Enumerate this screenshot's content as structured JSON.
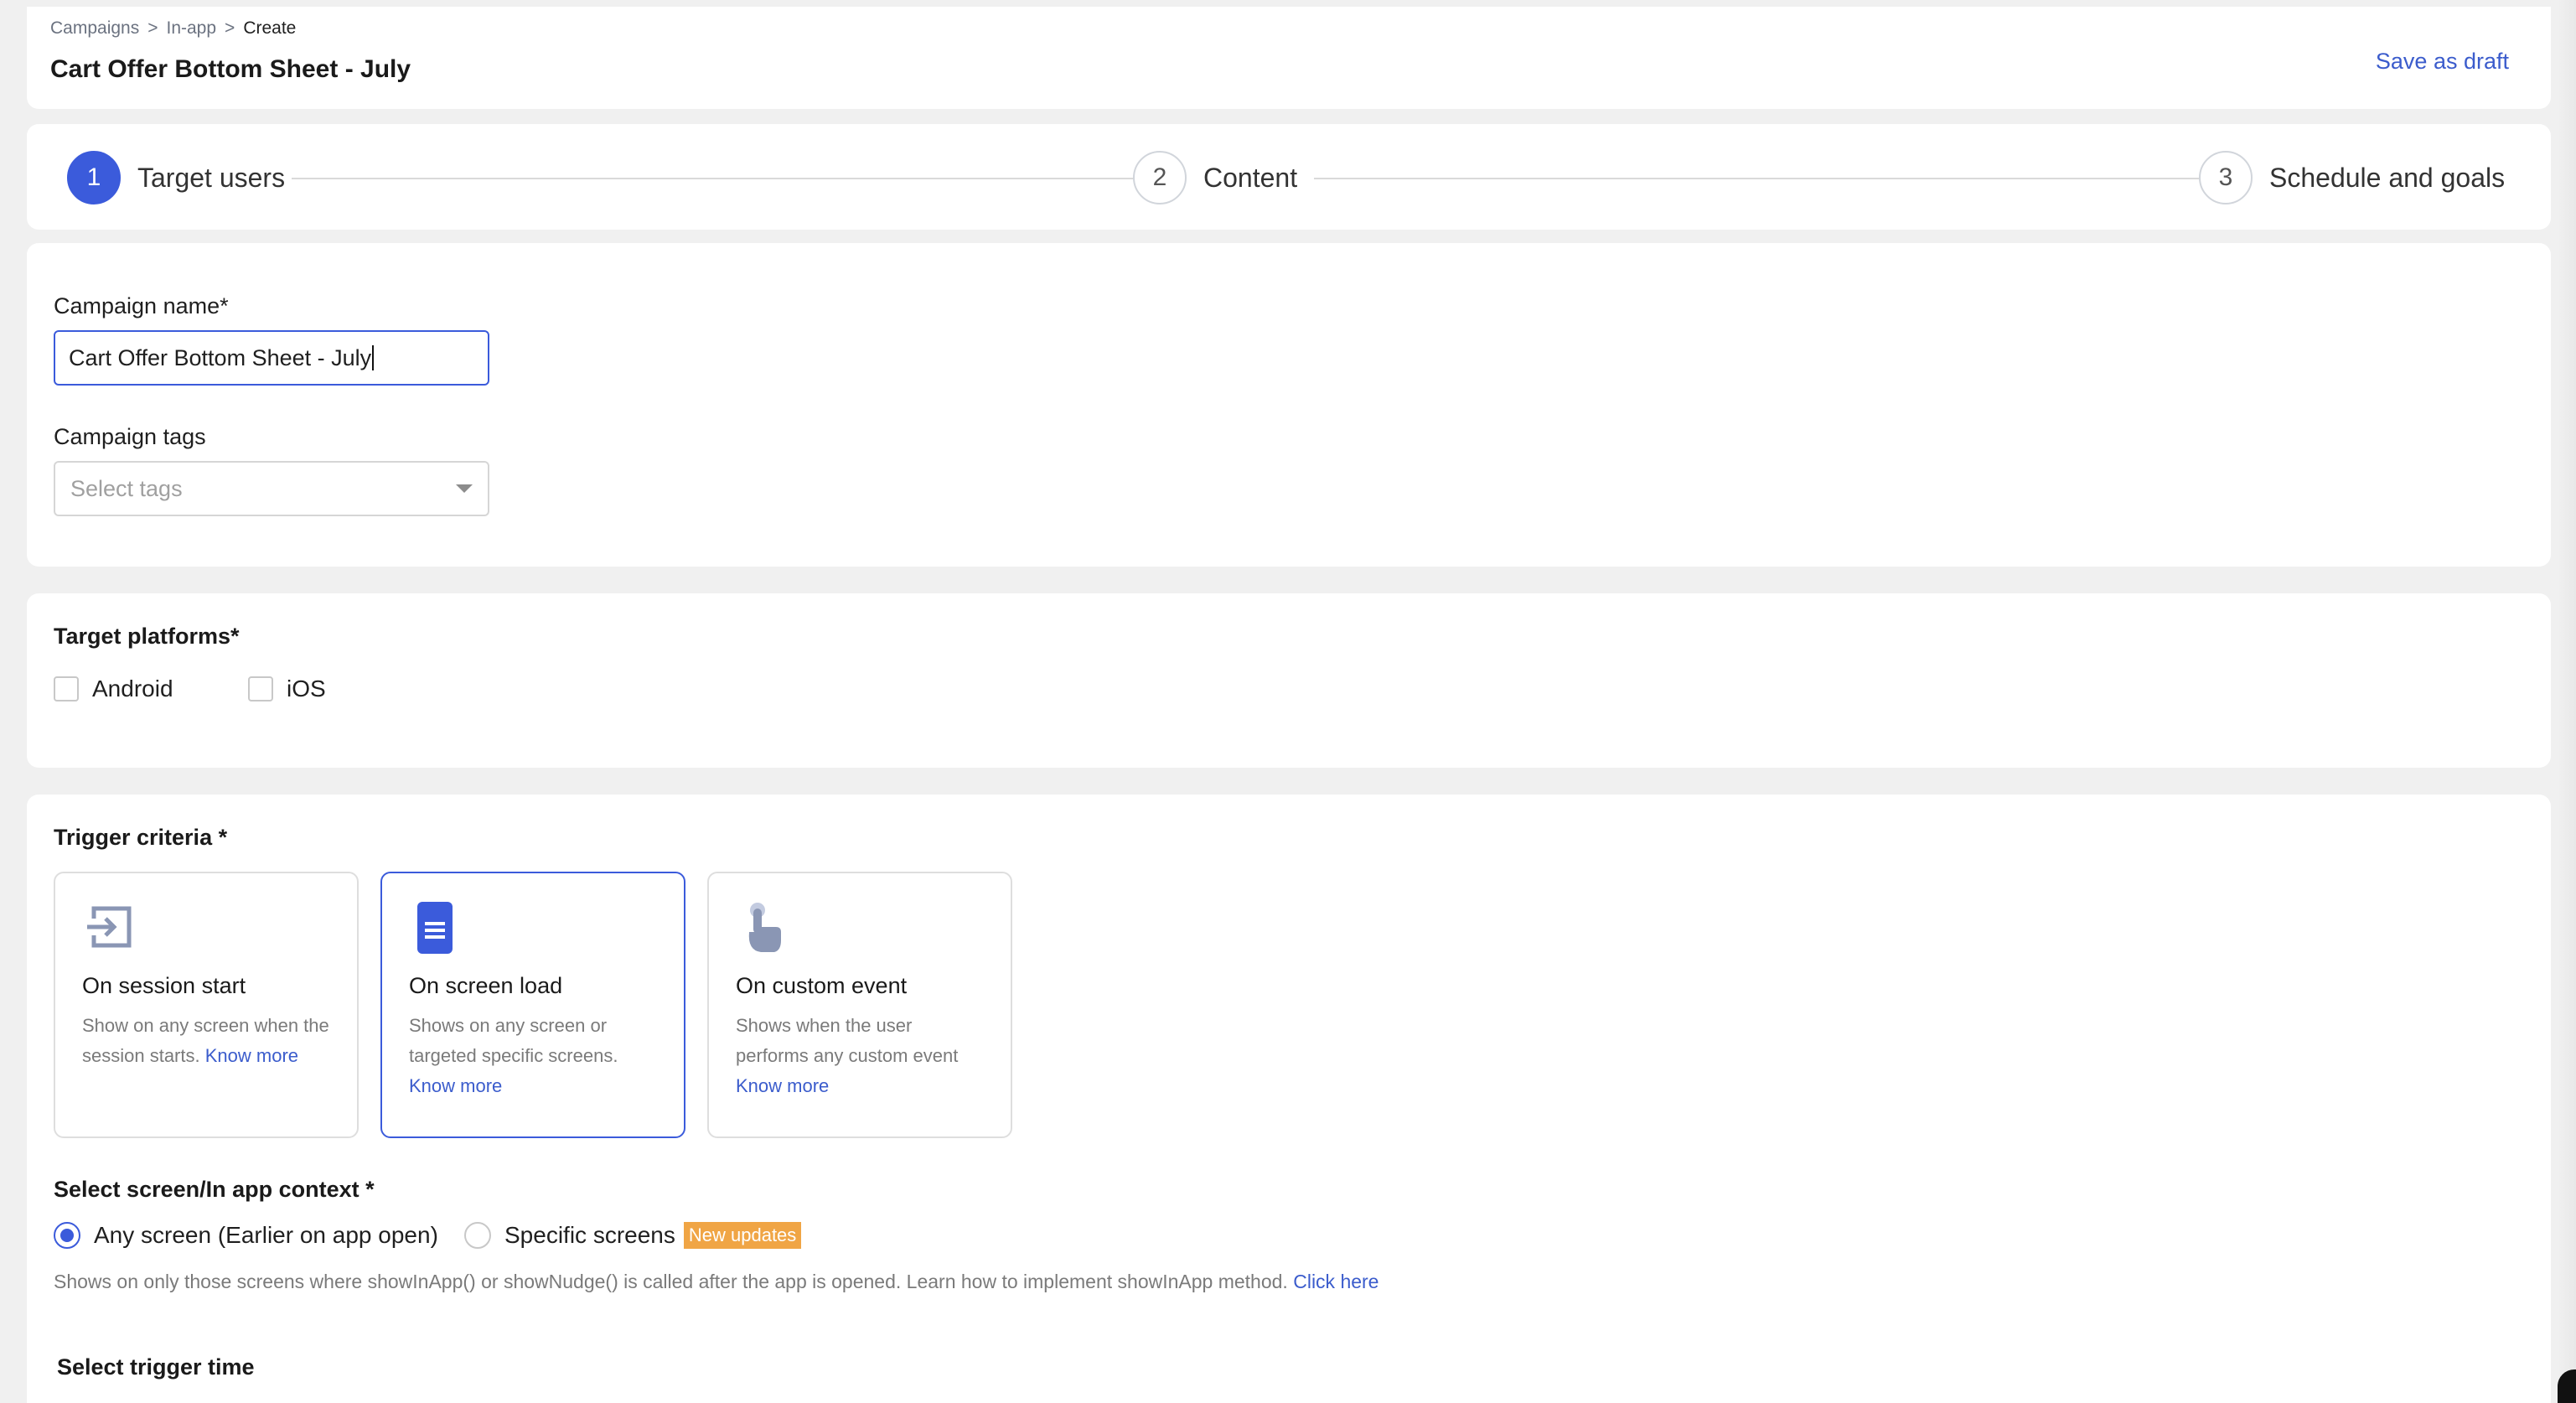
{
  "breadcrumb": [
    "Campaigns",
    ">",
    "In-app",
    ">",
    "Create"
  ],
  "header": {
    "title": "Cart Offer Bottom Sheet - July",
    "save_draft": "Save as draft"
  },
  "stepper": [
    {
      "num": "1",
      "label": "Target users",
      "active": true
    },
    {
      "num": "2",
      "label": "Content",
      "active": false
    },
    {
      "num": "3",
      "label": "Schedule and goals",
      "active": false
    }
  ],
  "campaign": {
    "name_label": "Campaign name*",
    "name_value": "Cart Offer Bottom Sheet - July",
    "tags_label": "Campaign tags",
    "tags_placeholder": "Select tags"
  },
  "platforms": {
    "title": "Target platforms*",
    "options": [
      {
        "label": "Android",
        "checked": false
      },
      {
        "label": "iOS",
        "checked": false
      }
    ]
  },
  "trigger": {
    "title": "Trigger criteria *",
    "cards": [
      {
        "icon": "session-start-icon",
        "title": "On session start",
        "desc": "Show on any screen when the session starts.",
        "link": "Know more",
        "selected": false
      },
      {
        "icon": "screen-load-icon",
        "title": "On screen load",
        "desc": "Shows on any screen or targeted specific screens.",
        "link": "Know more",
        "selected": true
      },
      {
        "icon": "custom-event-icon",
        "title": "On custom event",
        "desc": "Shows when the user performs any custom event",
        "link": "Know more",
        "selected": false
      }
    ]
  },
  "context": {
    "title": "Select screen/In app context *",
    "options": [
      {
        "label": "Any screen (Earlier on app open)",
        "checked": true
      },
      {
        "label": "Specific screens",
        "checked": false,
        "badge": "New updates"
      }
    ],
    "helper": "Shows on only those screens where showInApp() or showNudge() is called after the app is opened. Learn how to implement showInApp method.",
    "helper_link": "Click here"
  },
  "trigger_time": {
    "title": "Select trigger time"
  },
  "colors": {
    "accent": "#3b5bdb",
    "link": "#3b5ccc",
    "badge": "#f0a545"
  }
}
